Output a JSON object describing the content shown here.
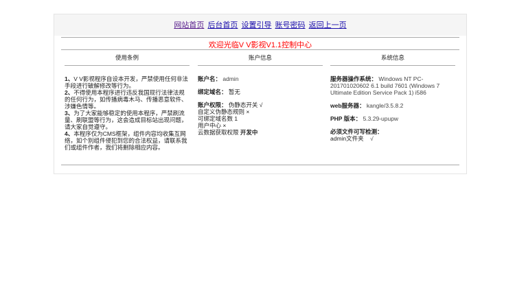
{
  "nav": [
    "网站首页",
    "后台首页",
    "设置引导",
    "账号密码",
    "返回上一页"
  ],
  "welcome": "欢迎光临V V影视V1.1控制中心",
  "columns": {
    "usage": "使用条例",
    "account": "账户信息",
    "system": "系统信息"
  },
  "usage": [
    {
      "num": "1、",
      "text": "V V影视程序自设本开发，严禁使用任何非法手段进行破解修改等行为。"
    },
    {
      "num": "2、",
      "text": "不得使用本程序进行违反我国现行法律法规的任何行为，如传播病毒木马、传播恶意软件、涉嫌色情等。"
    },
    {
      "num": "3、",
      "text": "为了大家能够稳定的使用本程序，严禁刷流量、刷联盟等行为，这会造成目标站出现问题，请大家自觉遵守。"
    },
    {
      "num": "4、",
      "text": "本程序仅为CMS框架，组件内容均收集互网络，如个别组件侵犯到您的合法权益，请联系我们或组件作者，我们将删除相应内容。"
    }
  ],
  "account": {
    "name_label": "账户名：",
    "name": "admin",
    "domain_label": "绑定域名：",
    "domain": "暂无",
    "perm_label": "账户权限：",
    "perm_lines": [
      "伪静态开关 √",
      "自定义伪静态规则 ×",
      "可绑定域名数 1",
      "用户中心 ×"
    ],
    "cloud_label": "云数据获取权限",
    "cloud_value": "开发中"
  },
  "system": {
    "os_label": "服务器操作系统：",
    "os": "Windows NT PC-201701020602 6.1 build 7601 (Windows 7 Ultimate Edition Service Pack 1) i586",
    "web_label": "web服务器：",
    "web": "kangle/3.5.8.2",
    "php_label": "PHP 版本：",
    "php": "5.3.29-upupw",
    "check_label": "必须文件可写检测：",
    "check_item": "admin文件夹",
    "check_mark": "√"
  }
}
